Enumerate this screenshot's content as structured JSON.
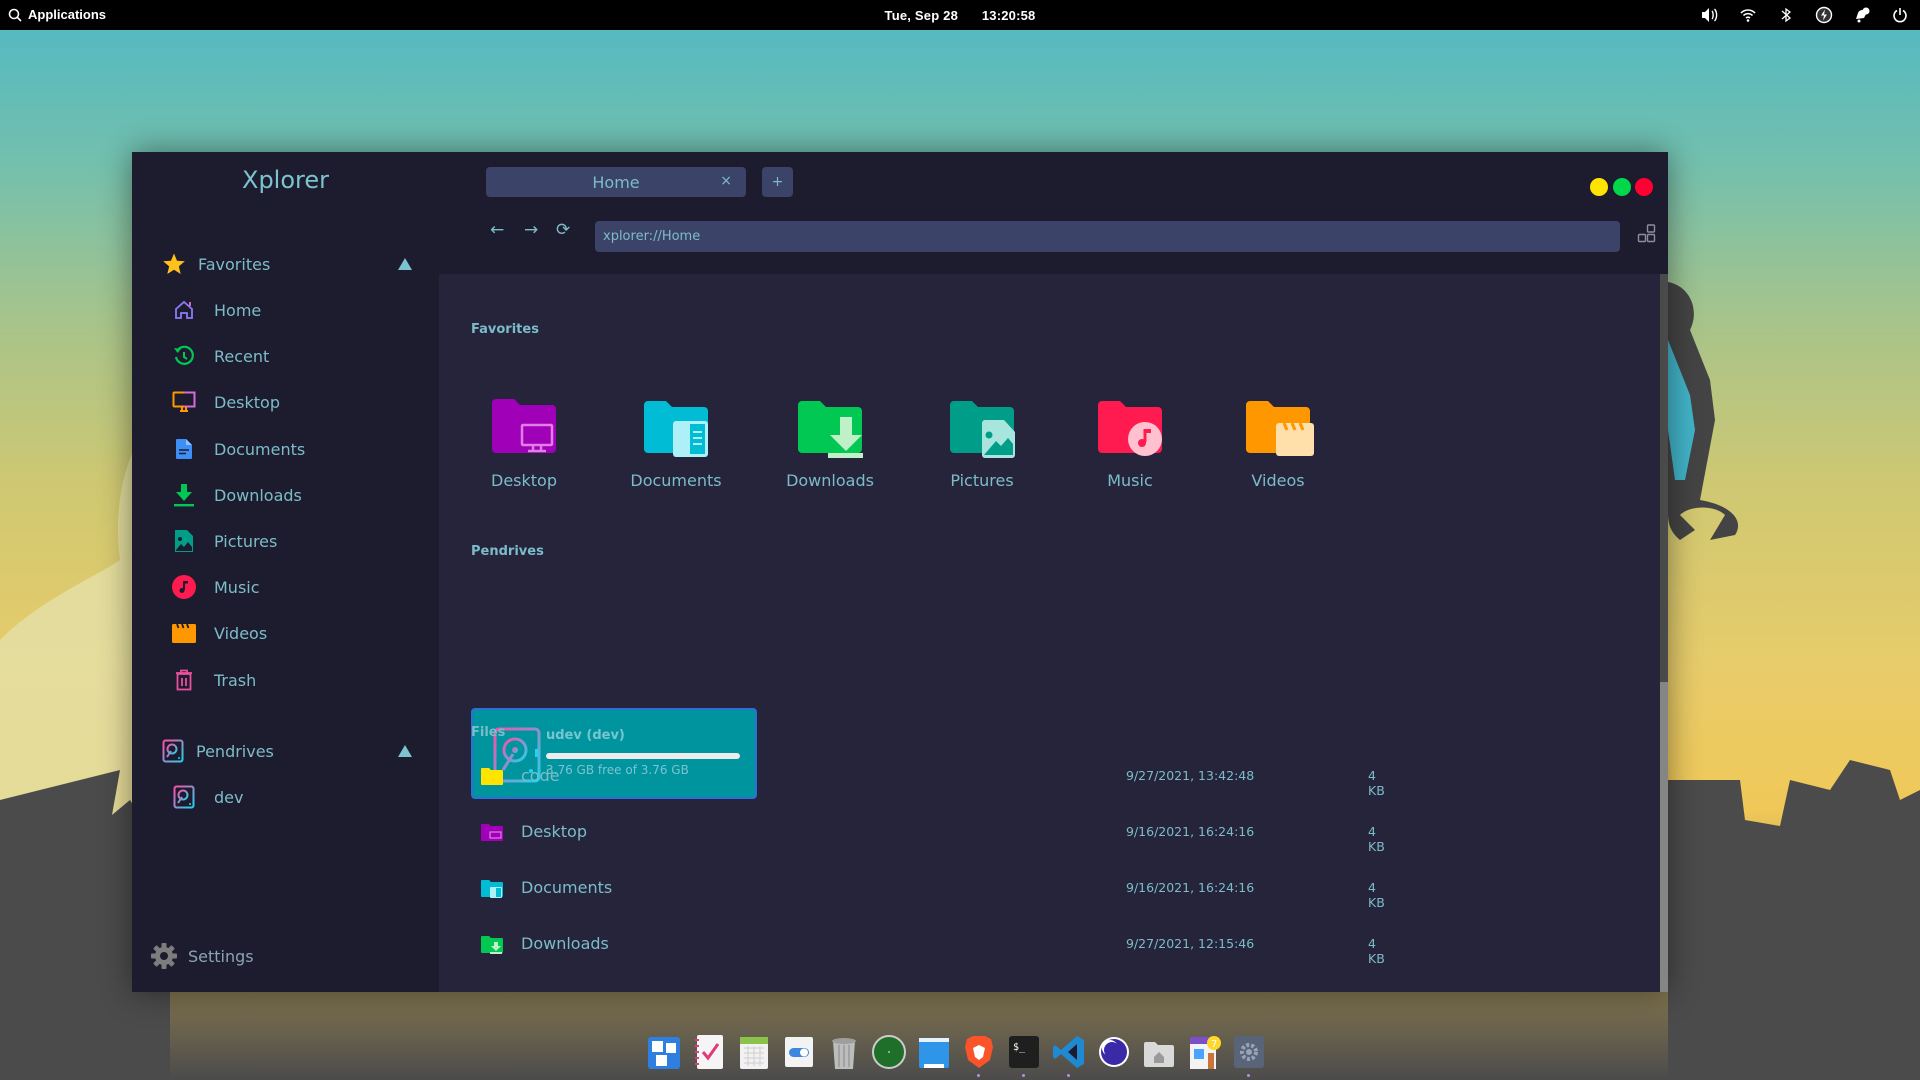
{
  "topbar": {
    "applications_label": "Applications",
    "date": "Tue, Sep 28",
    "time": "13:20:58",
    "tray_icons": [
      "volume-icon",
      "wifi-icon",
      "bluetooth-icon",
      "power-profile-icon",
      "notifications-icon",
      "power-icon"
    ]
  },
  "window": {
    "app_title": "Xplorer",
    "tab": {
      "label": "Home",
      "close_label": "×"
    },
    "new_tab_label": "+",
    "window_controls": {
      "minimize_color": "#ffe400",
      "maximize_color": "#00d84a",
      "close_color": "#ff0033"
    },
    "nav": {
      "back": "←",
      "forward": "→",
      "reload": "⟳"
    },
    "address": "xplorer://Home"
  },
  "sidebar": {
    "favorites_label": "Favorites",
    "items": [
      {
        "label": "Home",
        "icon": "home-icon"
      },
      {
        "label": "Recent",
        "icon": "recent-icon"
      },
      {
        "label": "Desktop",
        "icon": "desktop-icon"
      },
      {
        "label": "Documents",
        "icon": "documents-icon"
      },
      {
        "label": "Downloads",
        "icon": "downloads-icon"
      },
      {
        "label": "Pictures",
        "icon": "pictures-icon"
      },
      {
        "label": "Music",
        "icon": "music-icon"
      },
      {
        "label": "Videos",
        "icon": "videos-icon"
      },
      {
        "label": "Trash",
        "icon": "trash-icon"
      }
    ],
    "pendrives_label": "Pendrives",
    "pendrives": [
      {
        "label": "dev",
        "icon": "drive-icon"
      }
    ],
    "settings_label": "Settings"
  },
  "main": {
    "favorites_title": "Favorites",
    "favorites": [
      {
        "label": "Desktop",
        "color": "#a000b8"
      },
      {
        "label": "Documents",
        "color": "#00bcd4"
      },
      {
        "label": "Downloads",
        "color": "#00c853"
      },
      {
        "label": "Pictures",
        "color": "#009e88"
      },
      {
        "label": "Music",
        "color": "#ff1a4f"
      },
      {
        "label": "Videos",
        "color": "#ff9800"
      }
    ],
    "pendrives_title": "Pendrives",
    "drive": {
      "name": "udev (dev)",
      "free_text": "3.76 GB free of 3.76 GB",
      "free_fraction": 1.0
    },
    "files_title": "Files",
    "files": [
      {
        "name": "code",
        "modified": "9/27/2021, 13:42:48",
        "size": "4 KB",
        "type": "folder",
        "color": "#ffe400"
      },
      {
        "name": "Desktop",
        "modified": "9/16/2021, 16:24:16",
        "size": "4 KB",
        "type": "desktop-folder",
        "color": "#a000b8"
      },
      {
        "name": "Documents",
        "modified": "9/16/2021, 16:24:16",
        "size": "4 KB",
        "type": "documents-folder",
        "color": "#00bcd4"
      },
      {
        "name": "Downloads",
        "modified": "9/27/2021, 12:15:46",
        "size": "4 KB",
        "type": "downloads-folder",
        "color": "#00c853"
      }
    ]
  },
  "dock": {
    "apps": [
      "Multitasking View",
      "Tasks",
      "Calendar",
      "Switchboard Toggle",
      "Trash",
      "Radar",
      "Files Window",
      "Brave",
      "Terminal",
      "VS Code",
      "Eclipse",
      "Home Folder",
      "AppCenter",
      "Settings"
    ],
    "appcenter_badge": "7"
  }
}
